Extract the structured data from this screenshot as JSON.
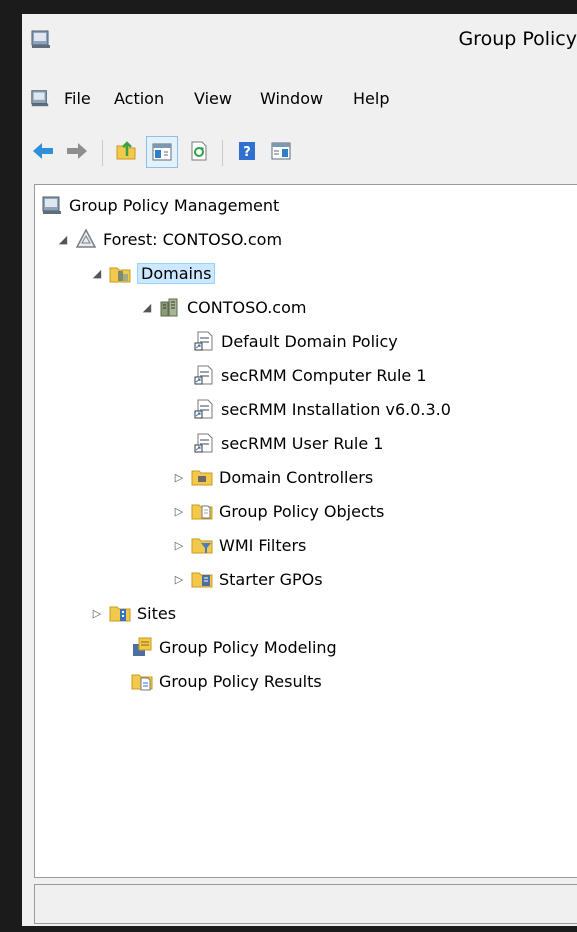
{
  "window": {
    "title": "Group Policy"
  },
  "menu": [
    "File",
    "Action",
    "View",
    "Window",
    "Help"
  ],
  "toolbar_icons": [
    "back-icon",
    "forward-icon",
    "up-folder-icon",
    "show-hide-tree-icon",
    "refresh-icon",
    "help-icon",
    "properties-icon"
  ],
  "tree": {
    "root": "Group Policy Management",
    "forest": "Forest: CONTOSO.com",
    "domains": "Domains",
    "domain": "CONTOSO.com",
    "gpo_links": [
      "Default Domain Policy",
      "secRMM Computer Rule 1",
      "secRMM Installation v6.0.3.0",
      "secRMM User Rule 1"
    ],
    "containers": [
      "Domain Controllers",
      "Group Policy Objects",
      "WMI Filters",
      "Starter GPOs"
    ],
    "sites": "Sites",
    "modeling": "Group Policy Modeling",
    "results": "Group Policy Results"
  },
  "colors": {
    "selection": "#cce8ff",
    "window_bg": "#f0f0f0",
    "tree_bg": "#ffffff"
  }
}
